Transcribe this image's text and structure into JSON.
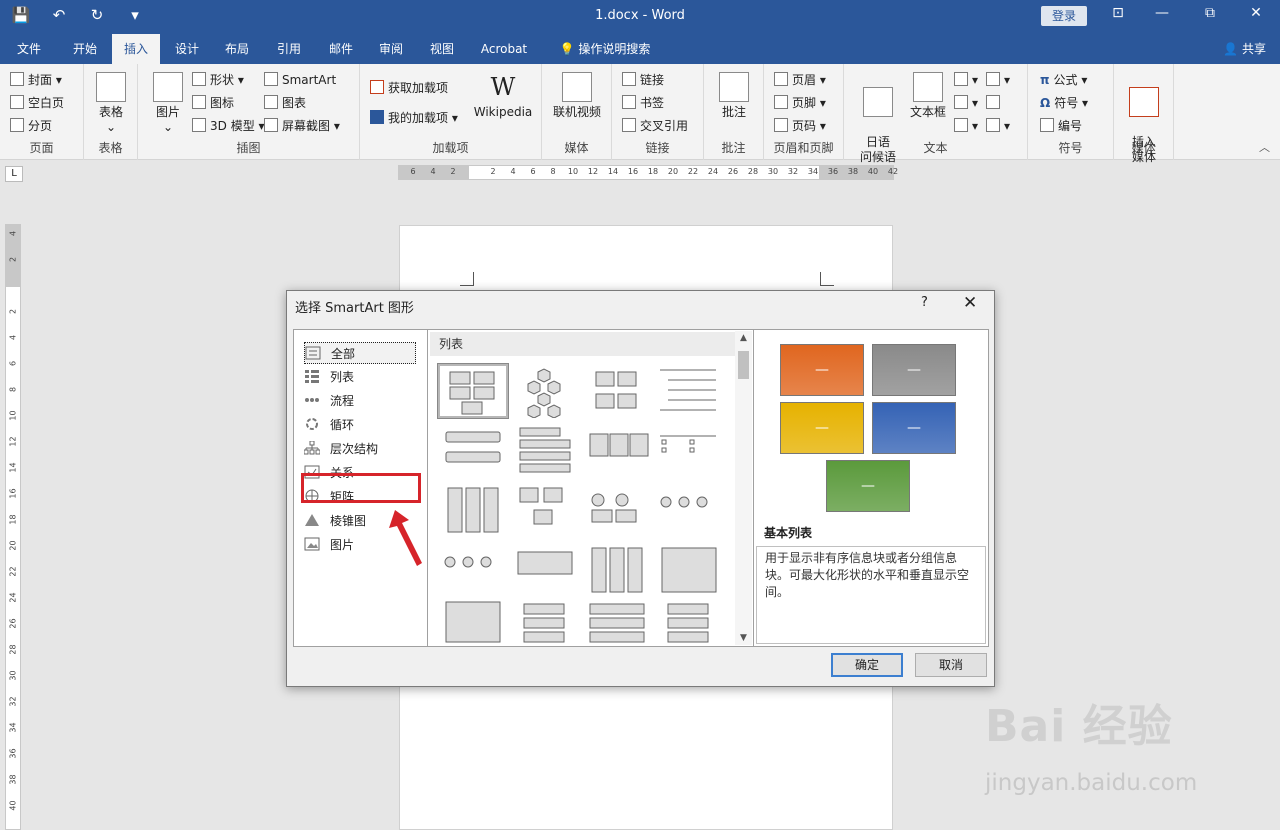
{
  "window": {
    "title": "1.docx - Word",
    "login_label": "登录",
    "controls": [
      "⊡",
      "—",
      "⧉",
      "✕"
    ]
  },
  "qat": {
    "save": "💾",
    "undo": "↶",
    "redo": "↻",
    "customize": "▾"
  },
  "tabs": [
    "文件",
    "开始",
    "插入",
    "设计",
    "布局",
    "引用",
    "邮件",
    "审阅",
    "视图",
    "Acrobat",
    "操作说明搜索"
  ],
  "active_tab": "插入",
  "share_label": "共享",
  "ribbon": {
    "pages": {
      "items": [
        "封面",
        "空白页",
        "分页"
      ],
      "label": "页面"
    },
    "table": {
      "item": "表格",
      "label": "表格"
    },
    "illustrations": {
      "picture": "图片",
      "items": [
        "形状",
        "图标",
        "3D 模型"
      ],
      "items2": [
        "SmartArt",
        "图表",
        "屏幕截图"
      ],
      "label": "插图"
    },
    "addins": {
      "items": [
        "获取加载项",
        "我的加载项"
      ],
      "wikipedia": "Wikipedia",
      "label": "加载项"
    },
    "media": {
      "item": "联机视频",
      "label": "媒体"
    },
    "links": {
      "items": [
        "链接",
        "书签",
        "交叉引用"
      ],
      "label": "链接"
    },
    "comments": {
      "item": "批注",
      "label": "批注"
    },
    "header_footer": {
      "items": [
        "页眉",
        "页脚",
        "页码"
      ],
      "label": "页眉和页脚"
    },
    "text": {
      "item1": "日语\n问候语",
      "item2": "文本框",
      "label": "文本"
    },
    "symbols": {
      "items": [
        "公式",
        "符号",
        "编号"
      ],
      "label": "符号"
    },
    "media2": {
      "item": "插入\n媒体",
      "label": "媒体"
    }
  },
  "ruler": {
    "corner": "L",
    "h_ticks": [
      "6",
      "4",
      "2",
      "",
      "2",
      "4",
      "6",
      "8",
      "10",
      "12",
      "14",
      "16",
      "18",
      "20",
      "22",
      "24",
      "26",
      "28",
      "30",
      "32",
      "34",
      "36",
      "38",
      "40",
      "42"
    ],
    "v_ticks": [
      "4",
      "2",
      "",
      "2",
      "4",
      "6",
      "8",
      "10",
      "12",
      "14",
      "16",
      "18",
      "20",
      "22",
      "24",
      "26",
      "28",
      "30",
      "32",
      "34",
      "36",
      "38",
      "40"
    ]
  },
  "dialog": {
    "title": "选择 SmartArt 图形",
    "help": "?",
    "close": "✕",
    "categories": [
      "全部",
      "列表",
      "流程",
      "循环",
      "层次结构",
      "关系",
      "矩阵",
      "棱锥图",
      "图片"
    ],
    "selected_category": "全部",
    "highlighted_category": "层次结构",
    "gallery_header": "列表",
    "preview": {
      "box_text": "—",
      "colors": [
        "#e0661f",
        "#8a8a8a",
        "#e6b200",
        "#3563b5",
        "#5b9a3c"
      ],
      "title": "基本列表",
      "description": "用于显示非有序信息块或者分组信息块。可最大化形状的水平和垂直显示空间。"
    },
    "ok": "确定",
    "cancel": "取消"
  },
  "watermark": {
    "brand": "Bai 经验",
    "url": "jingyan.baidu.com"
  }
}
